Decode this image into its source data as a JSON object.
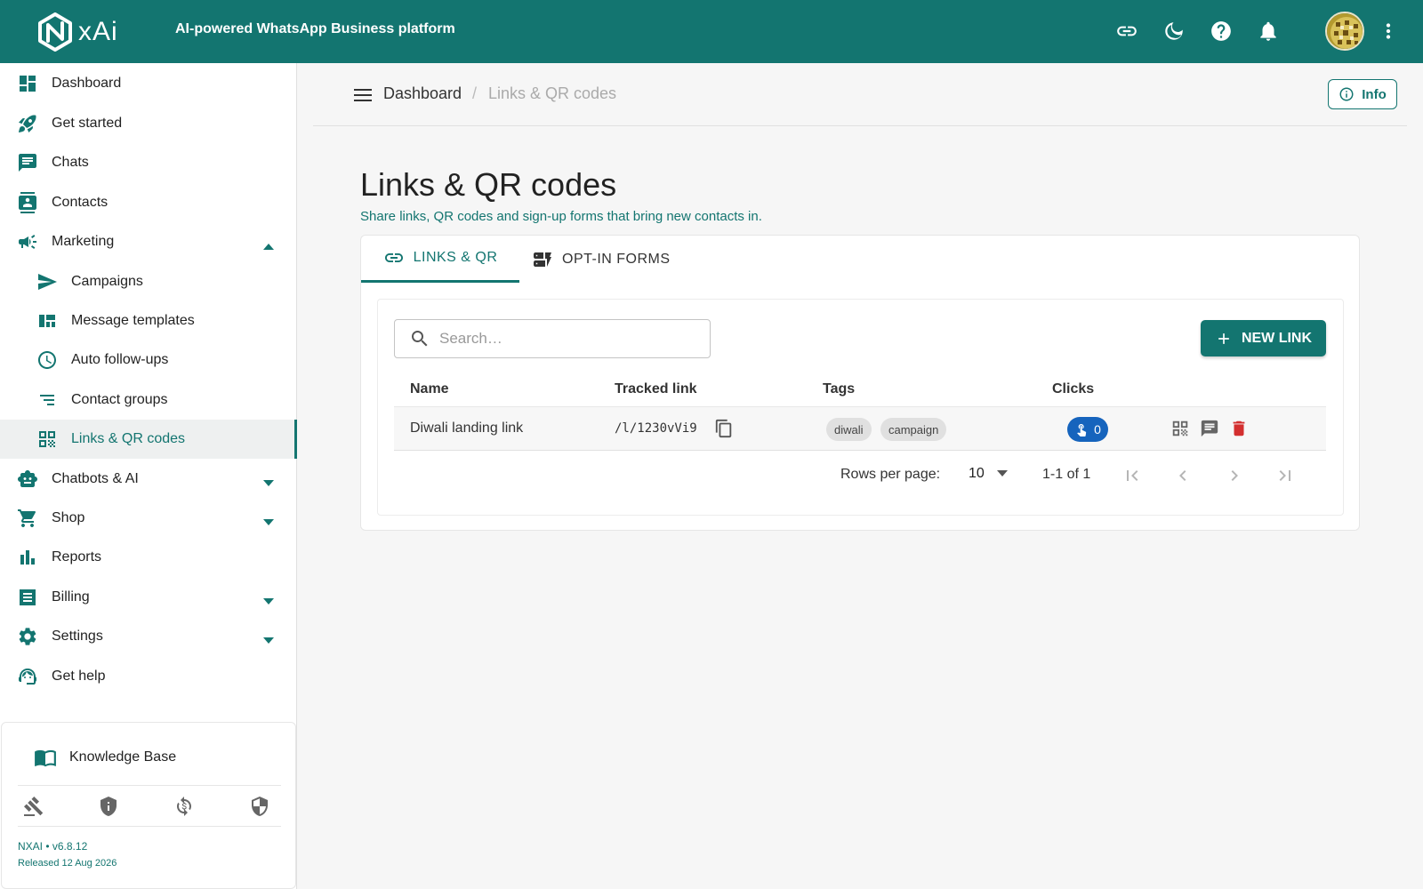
{
  "header": {
    "brand": "xAi",
    "tagline": "AI-powered WhatsApp Business platform",
    "icons": [
      "link-icon",
      "moon-icon",
      "help-icon",
      "bell-icon",
      "avatar",
      "more-vert-icon"
    ],
    "accent": "#137570"
  },
  "sidebar": {
    "items": [
      {
        "label": "Dashboard",
        "icon": "dashboard-icon"
      },
      {
        "label": "Get started",
        "icon": "rocket-icon"
      },
      {
        "label": "Chats",
        "icon": "chat-icon"
      },
      {
        "label": "Contacts",
        "icon": "contacts-icon"
      },
      {
        "label": "Marketing",
        "icon": "megaphone-icon",
        "expanded": true
      },
      {
        "label": "Campaigns",
        "icon": "send-icon"
      },
      {
        "label": "Message templates",
        "icon": "template-icon"
      },
      {
        "label": "Auto follow-ups",
        "icon": "clock-icon"
      },
      {
        "label": "Contact groups",
        "icon": "list-icon"
      },
      {
        "label": "Links & QR codes",
        "icon": "qr-icon",
        "active": true
      },
      {
        "label": "Chatbots & AI",
        "icon": "robot-icon"
      },
      {
        "label": "Shop",
        "icon": "cart-icon"
      },
      {
        "label": "Reports",
        "icon": "bar-chart-icon"
      },
      {
        "label": "Billing",
        "icon": "receipt-icon"
      },
      {
        "label": "Settings",
        "icon": "gear-icon"
      },
      {
        "label": "Get help",
        "icon": "support-icon"
      }
    ],
    "knowledge_base": "Knowledge Base",
    "footer_icons": [
      "gavel-icon",
      "shield-info-icon",
      "currency-sync-icon",
      "security-icon"
    ],
    "version": "NXAI • v6.8.12",
    "released": "Released 12 Aug 2026"
  },
  "breadcrumb": {
    "home": "Dashboard",
    "separator": "/",
    "current": "Links & QR codes"
  },
  "info_button": "Info",
  "page": {
    "title": "Links & QR codes",
    "subtitle": "Share links, QR codes and sign-up forms that bring new contacts in."
  },
  "tabs": [
    {
      "label": "LINKS & QR",
      "active": true
    },
    {
      "label": "OPT-IN FORMS",
      "active": false
    }
  ],
  "search": {
    "placeholder": "Search…",
    "value": ""
  },
  "new_link_button": "NEW LINK",
  "table": {
    "columns": [
      "Name",
      "Tracked link",
      "Tags",
      "Clicks"
    ],
    "rows": [
      {
        "name": "Diwali landing link",
        "tracked_link": "/l/1230vVi9",
        "tags": [
          "diwali",
          "campaign"
        ],
        "clicks": "0"
      }
    ]
  },
  "pagination": {
    "rows_per_page_label": "Rows per page:",
    "rows_per_page": "10",
    "range": "1-1 of 1"
  },
  "colors": {
    "primary": "#137570",
    "clicks_badge": "#1664bd",
    "delete": "#d32f2f"
  }
}
